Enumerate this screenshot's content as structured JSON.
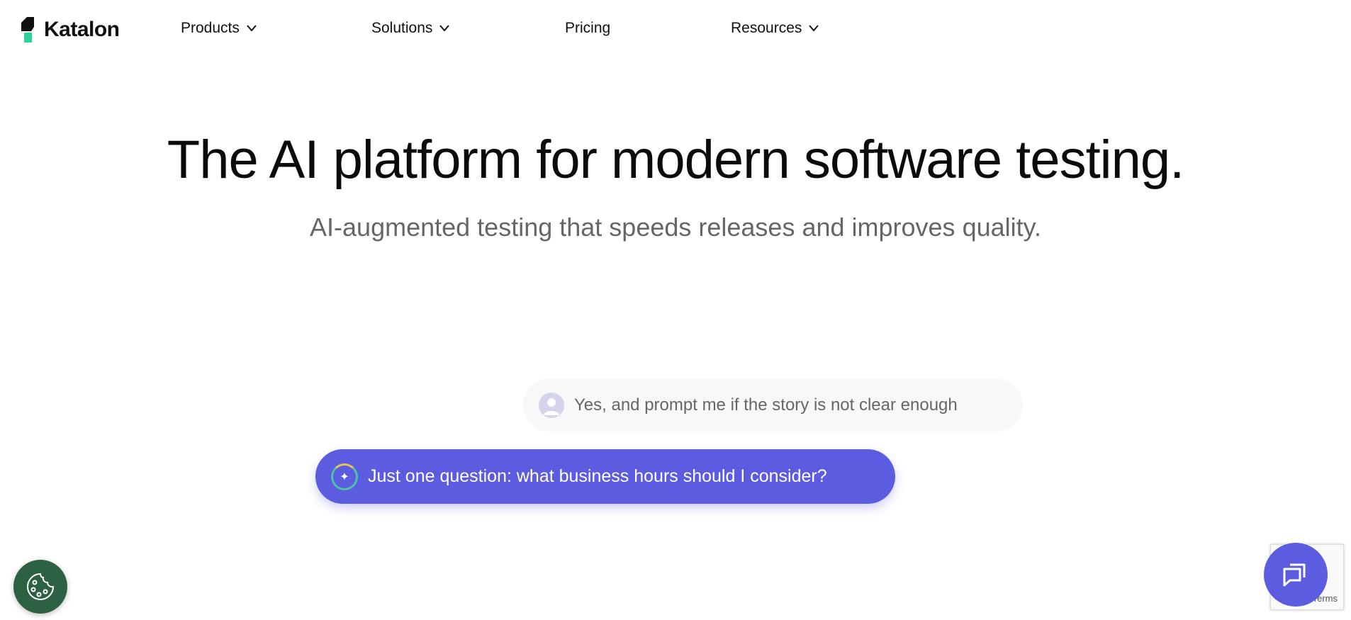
{
  "brand": {
    "name": "Katalon",
    "accent": "#2fd39a"
  },
  "nav": [
    {
      "label": "Products",
      "dropdown": true
    },
    {
      "label": "Solutions",
      "dropdown": true
    },
    {
      "label": "Pricing",
      "dropdown": false
    },
    {
      "label": "Resources",
      "dropdown": true
    }
  ],
  "hero": {
    "title": "The AI platform for modern software testing.",
    "subtitle": "AI-augmented testing that speeds releases and improves quality."
  },
  "chat_demo": {
    "user_message": "Yes, and prompt me if the story is not clear enough",
    "ai_message": "Just one question: what business hours should I consider?"
  },
  "recaptcha": {
    "text": "Terms"
  },
  "icons": {
    "cookie": "cookie-icon",
    "chat": "chat-bubbles-icon",
    "chevron": "⌄"
  }
}
